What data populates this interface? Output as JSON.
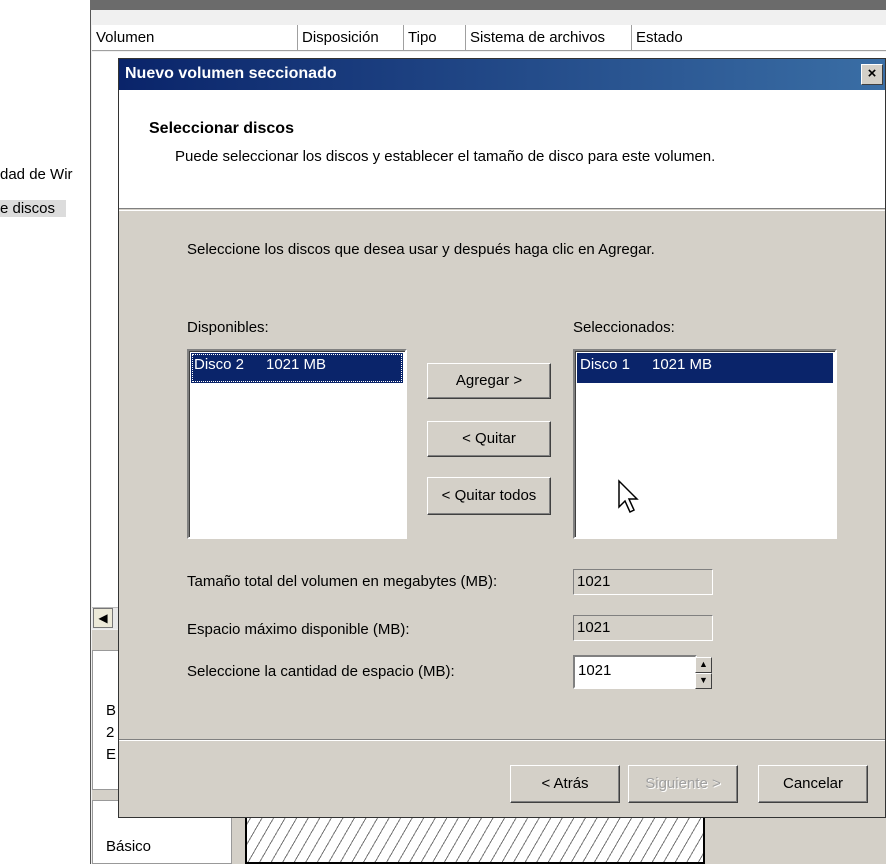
{
  "background": {
    "tree_items": [
      "dad de Wir",
      "e discos"
    ],
    "columns": [
      "Volumen",
      "Disposición",
      "Tipo",
      "Sistema de archivos",
      "Estado"
    ],
    "disk_fragments": [
      "B",
      "2",
      "E"
    ],
    "disk2_label": "Básico"
  },
  "dialog": {
    "title": "Nuevo volumen seccionado",
    "close_glyph": "×",
    "header_title": "Seleccionar discos",
    "header_desc": "Puede seleccionar los discos y establecer el tamaño de disco para este volumen.",
    "instruction": "Seleccione los discos que desea usar  y después haga clic en Agregar.",
    "available_label": "Disponibles:",
    "available": [
      {
        "name": "Disco 2",
        "size": "1021 MB"
      }
    ],
    "selected_label": "Seleccionados:",
    "selected": [
      {
        "name": "Disco 1",
        "size": "1021 MB"
      }
    ],
    "add_button": "Agregar >",
    "remove_button": "< Quitar",
    "remove_all_button": "< Quitar todos",
    "total_size_label": "Tamaño total del volumen en megabytes (MB):",
    "total_size_value": "1021",
    "max_space_label": "Espacio máximo disponible (MB):",
    "max_space_value": "1021",
    "amount_label": "Seleccione la cantidad de espacio (MB):",
    "amount_value": "1021",
    "back_button": "< Atrás",
    "next_button": "Siguiente >",
    "cancel_button": "Cancelar"
  },
  "icons": {
    "close": "close-icon",
    "spin_up": "spin-up-icon",
    "spin_down": "spin-down-icon",
    "scroll_left": "scroll-left-icon",
    "cursor": "mouse-cursor-icon"
  }
}
